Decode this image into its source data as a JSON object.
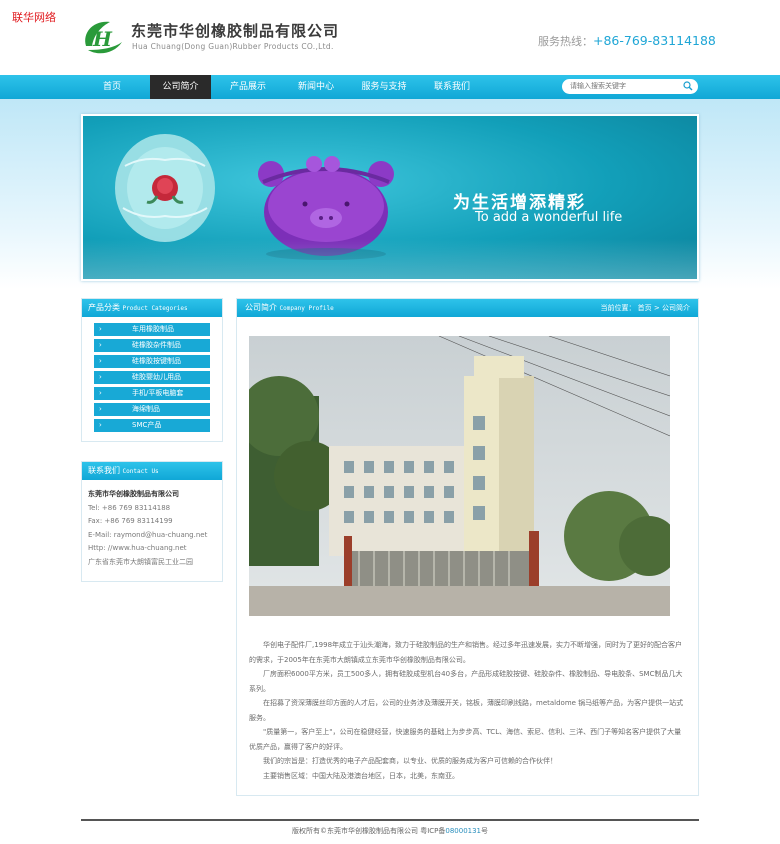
{
  "top": {
    "watermark": "联华网络",
    "company_cn": "东莞市华创橡胶制品有限公司",
    "company_en": "Hua Chuang(Dong Guan)Rubber Products CO.,Ltd.",
    "hotline_label": "服务热线：",
    "hotline_number": "+86-769-83114188"
  },
  "nav": {
    "items": [
      "首页",
      "公司简介",
      "产品展示",
      "新闻中心",
      "服务与支持",
      "联系我们"
    ],
    "active_index": 1
  },
  "search": {
    "placeholder": "请输入搜索关键字"
  },
  "banner": {
    "title_cn": "为生活增添精彩",
    "title_en": "To add a wonderful life"
  },
  "categories": {
    "title_cn": "产品分类",
    "title_en": "Product Categories",
    "items": [
      "车用橡胶制品",
      "硅橡胶杂件制品",
      "硅橡胶按键制品",
      "硅胶婴幼儿用品",
      "手机/平板电脑套",
      "海绵制品",
      "SMC产品"
    ]
  },
  "contact": {
    "title_cn": "联系我们",
    "title_en": "Contact Us",
    "company": "东莞市华创橡胶制品有限公司",
    "tel": "Tel: +86 769 83114188",
    "fax": "Fax: +86 769 83114199",
    "email": "E-Mail: raymond@hua-chuang.net",
    "http": "Http: //www.hua-chuang.net",
    "address": "广东省东莞市大朗镇富民工业二园"
  },
  "main": {
    "title_cn": "公司简介",
    "title_en": "Company Profile",
    "breadcrumb": "当前位置： 首页 > 公司简介",
    "paragraphs": [
      "华创电子配件厂,1998年成立于汕头潮海，致力于硅胶制品的生产和销售。经过多年迅速发展，实力不断增强，同时为了更好的配合客户的需求，于2005年在东莞市大朗镇成立东莞市华创橡胶制品有限公司。",
      "厂房面积6000平方米，员工500多人，拥有硅胶成型机台40多台，产品形成硅胶按键、硅胶杂件、橡胶制品、导电胶条、SMC制品几大系列。",
      "在招募了资深薄膜丝印方面的人才后，公司的业务涉及薄膜开关，铭板，薄膜印刷线路，metaldome 锅马纸等产品，为客户提供一站式服务。",
      "\"质量第一，客户至上\"，公司在稳健经营，快速服务的基础上为步步高、TCL、海信、索尼、信利、三洋、西门子等知名客户提供了大量优质产品，赢得了客户的好评。",
      "我们的宗旨是：打造优秀的电子产品配套商，以专业、优质的服务成为客户可信赖的合作伙伴！",
      "主要销售区域：中国大陆及港澳台地区，日本，北美，东南亚。"
    ]
  },
  "footer": {
    "copyright": "版权所有©东莞市华创橡胶制品有限公司 粤ICP备",
    "icp": "08000131",
    "suffix": "号"
  },
  "colors": {
    "accent": "#18a9d6",
    "nav_active": "#2a2a2a",
    "watermark": "#e0181d",
    "hotline": "#1fa6d6"
  }
}
